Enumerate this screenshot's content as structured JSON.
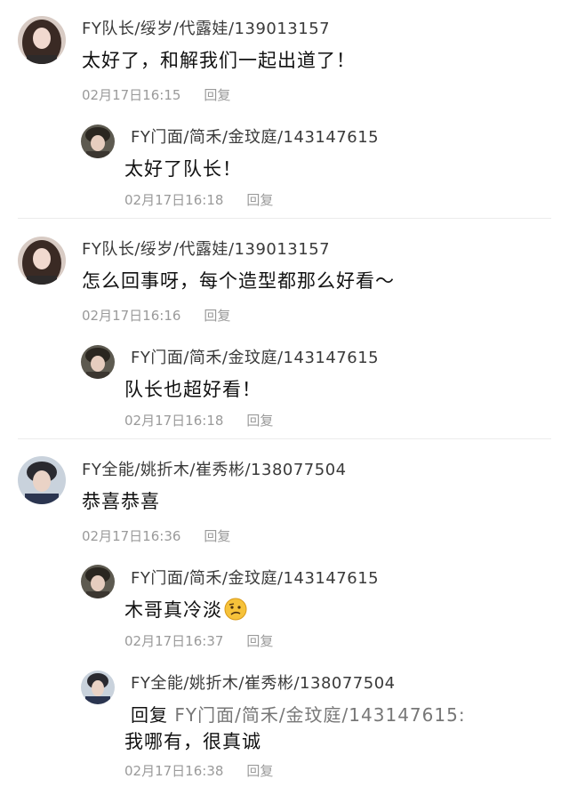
{
  "threads": [
    {
      "main": {
        "author": "FY队长/绥岁/代露娃/139013157",
        "text": "太好了，和解我们一起出道了！",
        "time": "02月17日16:15",
        "reply_label": "回复"
      },
      "replies": [
        {
          "author": "FY门面/简禾/金玟庭/143147615",
          "text": "太好了队长！",
          "time": "02月17日16:18",
          "reply_label": "回复"
        }
      ]
    },
    {
      "main": {
        "author": "FY队长/绥岁/代露娃/139013157",
        "text": "怎么回事呀，每个造型都那么好看～",
        "time": "02月17日16:16",
        "reply_label": "回复"
      },
      "replies": [
        {
          "author": "FY门面/简禾/金玟庭/143147615",
          "text": "队长也超好看！",
          "time": "02月17日16:18",
          "reply_label": "回复"
        }
      ]
    },
    {
      "main": {
        "author": "FY全能/姚折木/崔秀彬/138077504",
        "text": "恭喜恭喜",
        "time": "02月17日16:36",
        "reply_label": "回复"
      },
      "replies": [
        {
          "author": "FY门面/简禾/金玟庭/143147615",
          "text": "木哥真冷淡",
          "emoji": "confused-face-emoji",
          "time": "02月17日16:37",
          "reply_label": "回复"
        },
        {
          "author": "FY全能/姚折木/崔秀彬/138077504",
          "reply_prefix": "回复",
          "reply_to": "FY门面/简禾/金玟庭/143147615:",
          "text": "我哪有，很真诚",
          "time": "02月17日16:38",
          "reply_label": "回复"
        }
      ]
    }
  ],
  "colors": {
    "name": "#3a3a3a",
    "meta": "#9a9a9a",
    "divider": "#ececec",
    "emoji": "#f6c23a"
  }
}
